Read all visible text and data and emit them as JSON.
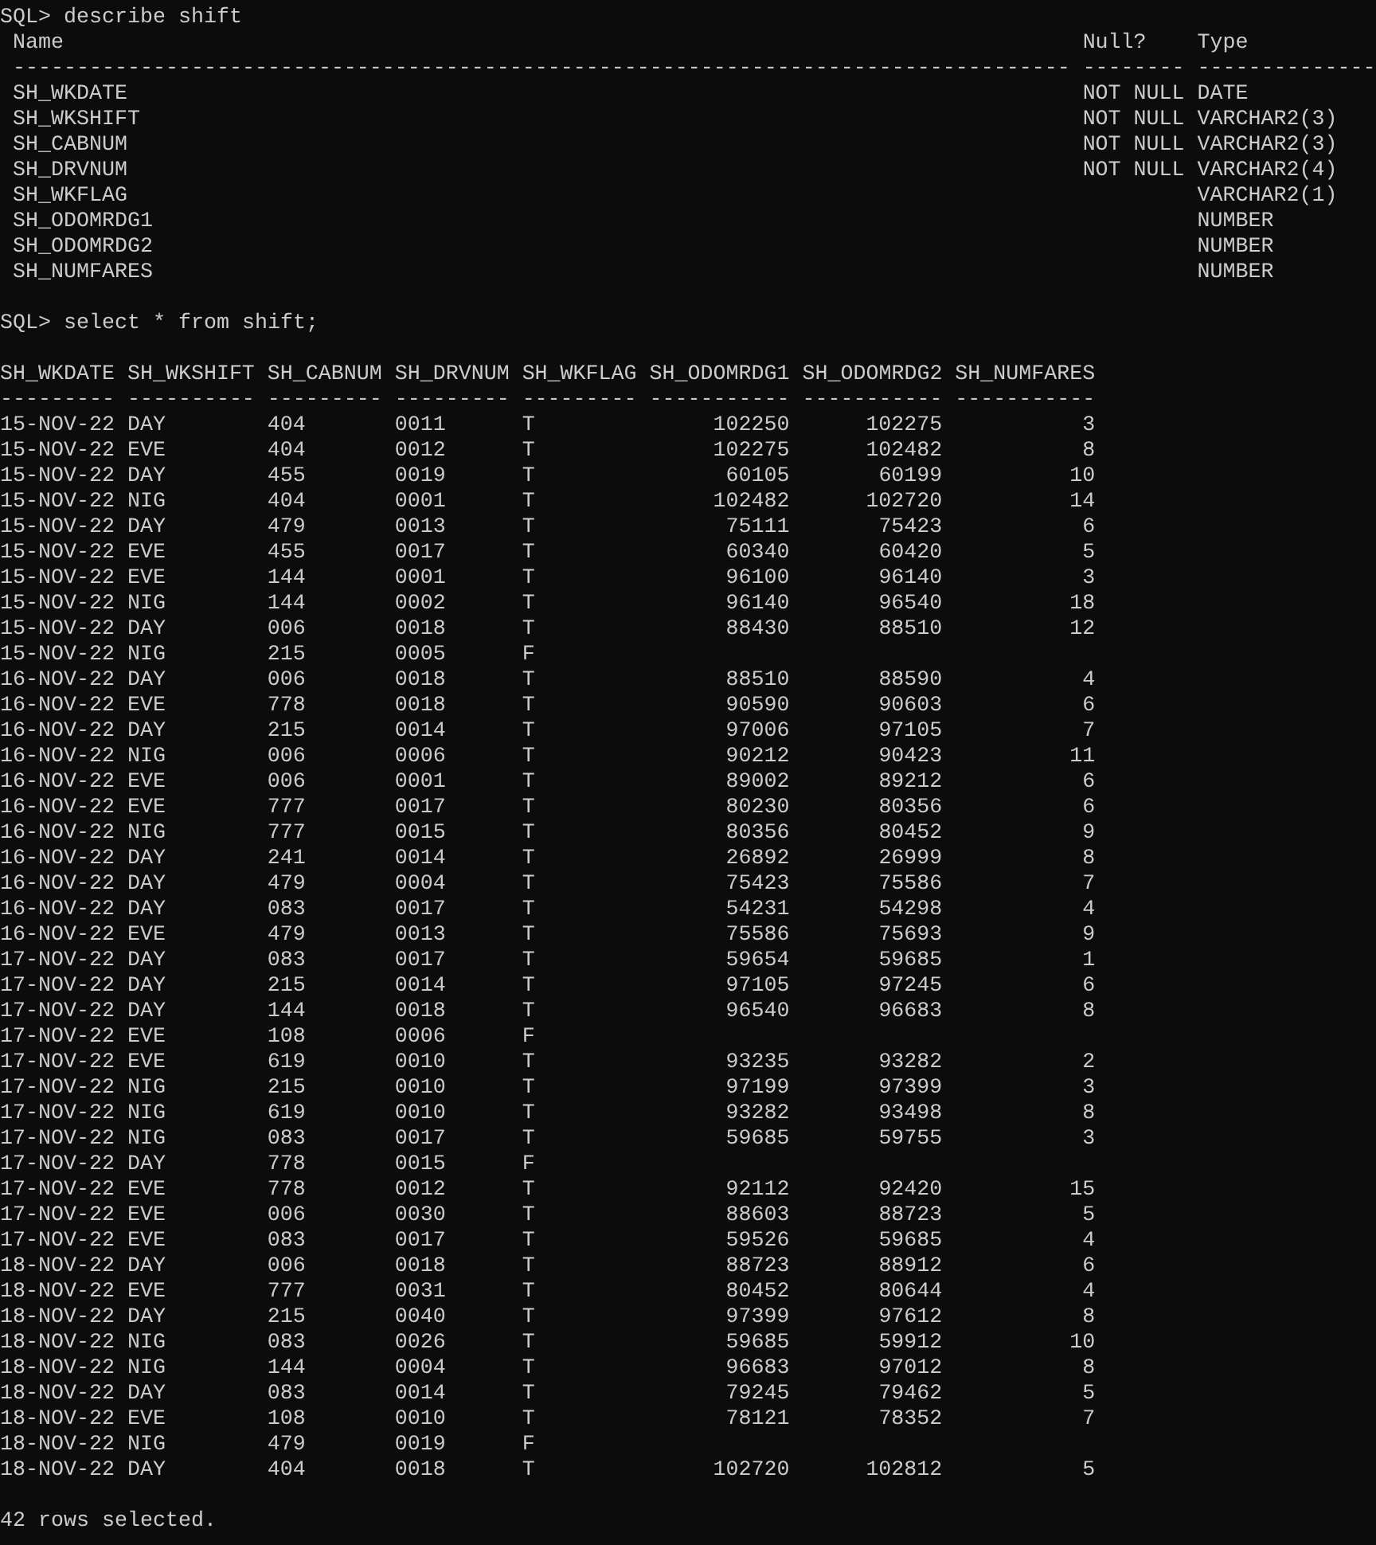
{
  "terminal": {
    "describe": {
      "command_line": "SQL> describe shift",
      "columns": [
        {
          "header": "Name",
          "rule": "-----------------------------------------------------------------------------------"
        },
        {
          "header": "Null?",
          "rule": "--------"
        },
        {
          "header": "Type",
          "rule": "--------------"
        }
      ],
      "rows": [
        [
          "SH_WKDATE",
          "NOT NULL",
          "DATE"
        ],
        [
          "SH_WKSHIFT",
          "NOT NULL",
          "VARCHAR2(3)"
        ],
        [
          "SH_CABNUM",
          "NOT NULL",
          "VARCHAR2(3)"
        ],
        [
          "SH_DRVNUM",
          "NOT NULL",
          "VARCHAR2(4)"
        ],
        [
          "SH_WKFLAG",
          null,
          "VARCHAR2(1)"
        ],
        [
          "SH_ODOMRDG1",
          null,
          "NUMBER"
        ],
        [
          "SH_ODOMRDG2",
          null,
          "NUMBER"
        ],
        [
          "SH_NUMFARES",
          null,
          "NUMBER"
        ]
      ]
    },
    "query": {
      "command_line": "SQL> select * from shift;",
      "columns": [
        {
          "header": "SH_WKDATE",
          "rule": "---------",
          "kind": "text"
        },
        {
          "header": "SH_WKSHIFT",
          "rule": "----------",
          "kind": "text"
        },
        {
          "header": "SH_CABNUM",
          "rule": "---------",
          "kind": "text"
        },
        {
          "header": "SH_DRVNUM",
          "rule": "---------",
          "kind": "text"
        },
        {
          "header": "SH_WKFLAG",
          "rule": "---------",
          "kind": "text"
        },
        {
          "header": "SH_ODOMRDG1",
          "rule": "-----------",
          "kind": "number"
        },
        {
          "header": "SH_ODOMRDG2",
          "rule": "-----------",
          "kind": "number"
        },
        {
          "header": "SH_NUMFARES",
          "rule": "-----------",
          "kind": "number"
        }
      ],
      "rows": [
        [
          "15-NOV-22",
          "DAY",
          "404",
          "0011",
          "T",
          "102250",
          "102275",
          "3"
        ],
        [
          "15-NOV-22",
          "EVE",
          "404",
          "0012",
          "T",
          "102275",
          "102482",
          "8"
        ],
        [
          "15-NOV-22",
          "DAY",
          "455",
          "0019",
          "T",
          "60105",
          "60199",
          "10"
        ],
        [
          "15-NOV-22",
          "NIG",
          "404",
          "0001",
          "T",
          "102482",
          "102720",
          "14"
        ],
        [
          "15-NOV-22",
          "DAY",
          "479",
          "0013",
          "T",
          "75111",
          "75423",
          "6"
        ],
        [
          "15-NOV-22",
          "EVE",
          "455",
          "0017",
          "T",
          "60340",
          "60420",
          "5"
        ],
        [
          "15-NOV-22",
          "EVE",
          "144",
          "0001",
          "T",
          "96100",
          "96140",
          "3"
        ],
        [
          "15-NOV-22",
          "NIG",
          "144",
          "0002",
          "T",
          "96140",
          "96540",
          "18"
        ],
        [
          "15-NOV-22",
          "DAY",
          "006",
          "0018",
          "T",
          "88430",
          "88510",
          "12"
        ],
        [
          "15-NOV-22",
          "NIG",
          "215",
          "0005",
          "F",
          null,
          null,
          null
        ],
        [
          "16-NOV-22",
          "DAY",
          "006",
          "0018",
          "T",
          "88510",
          "88590",
          "4"
        ],
        [
          "16-NOV-22",
          "EVE",
          "778",
          "0018",
          "T",
          "90590",
          "90603",
          "6"
        ],
        [
          "16-NOV-22",
          "DAY",
          "215",
          "0014",
          "T",
          "97006",
          "97105",
          "7"
        ],
        [
          "16-NOV-22",
          "NIG",
          "006",
          "0006",
          "T",
          "90212",
          "90423",
          "11"
        ],
        [
          "16-NOV-22",
          "EVE",
          "006",
          "0001",
          "T",
          "89002",
          "89212",
          "6"
        ],
        [
          "16-NOV-22",
          "EVE",
          "777",
          "0017",
          "T",
          "80230",
          "80356",
          "6"
        ],
        [
          "16-NOV-22",
          "NIG",
          "777",
          "0015",
          "T",
          "80356",
          "80452",
          "9"
        ],
        [
          "16-NOV-22",
          "DAY",
          "241",
          "0014",
          "T",
          "26892",
          "26999",
          "8"
        ],
        [
          "16-NOV-22",
          "DAY",
          "479",
          "0004",
          "T",
          "75423",
          "75586",
          "7"
        ],
        [
          "16-NOV-22",
          "DAY",
          "083",
          "0017",
          "T",
          "54231",
          "54298",
          "4"
        ],
        [
          "16-NOV-22",
          "EVE",
          "479",
          "0013",
          "T",
          "75586",
          "75693",
          "9"
        ],
        [
          "17-NOV-22",
          "DAY",
          "083",
          "0017",
          "T",
          "59654",
          "59685",
          "1"
        ],
        [
          "17-NOV-22",
          "DAY",
          "215",
          "0014",
          "T",
          "97105",
          "97245",
          "6"
        ],
        [
          "17-NOV-22",
          "DAY",
          "144",
          "0018",
          "T",
          "96540",
          "96683",
          "8"
        ],
        [
          "17-NOV-22",
          "EVE",
          "108",
          "0006",
          "F",
          null,
          null,
          null
        ],
        [
          "17-NOV-22",
          "EVE",
          "619",
          "0010",
          "T",
          "93235",
          "93282",
          "2"
        ],
        [
          "17-NOV-22",
          "NIG",
          "215",
          "0010",
          "T",
          "97199",
          "97399",
          "3"
        ],
        [
          "17-NOV-22",
          "NIG",
          "619",
          "0010",
          "T",
          "93282",
          "93498",
          "8"
        ],
        [
          "17-NOV-22",
          "NIG",
          "083",
          "0017",
          "T",
          "59685",
          "59755",
          "3"
        ],
        [
          "17-NOV-22",
          "DAY",
          "778",
          "0015",
          "F",
          null,
          null,
          null
        ],
        [
          "17-NOV-22",
          "EVE",
          "778",
          "0012",
          "T",
          "92112",
          "92420",
          "15"
        ],
        [
          "17-NOV-22",
          "EVE",
          "006",
          "0030",
          "T",
          "88603",
          "88723",
          "5"
        ],
        [
          "17-NOV-22",
          "EVE",
          "083",
          "0017",
          "T",
          "59526",
          "59685",
          "4"
        ],
        [
          "18-NOV-22",
          "DAY",
          "006",
          "0018",
          "T",
          "88723",
          "88912",
          "6"
        ],
        [
          "18-NOV-22",
          "EVE",
          "777",
          "0031",
          "T",
          "80452",
          "80644",
          "4"
        ],
        [
          "18-NOV-22",
          "DAY",
          "215",
          "0040",
          "T",
          "97399",
          "97612",
          "8"
        ],
        [
          "18-NOV-22",
          "NIG",
          "083",
          "0026",
          "T",
          "59685",
          "59912",
          "10"
        ],
        [
          "18-NOV-22",
          "NIG",
          "144",
          "0004",
          "T",
          "96683",
          "97012",
          "8"
        ],
        [
          "18-NOV-22",
          "DAY",
          "083",
          "0014",
          "T",
          "79245",
          "79462",
          "5"
        ],
        [
          "18-NOV-22",
          "EVE",
          "108",
          "0010",
          "T",
          "78121",
          "78352",
          "7"
        ],
        [
          "18-NOV-22",
          "NIG",
          "479",
          "0019",
          "F",
          null,
          null,
          null
        ],
        [
          "18-NOV-22",
          "DAY",
          "404",
          "0018",
          "T",
          "102720",
          "102812",
          "5"
        ]
      ],
      "footer": "42 rows selected."
    }
  }
}
